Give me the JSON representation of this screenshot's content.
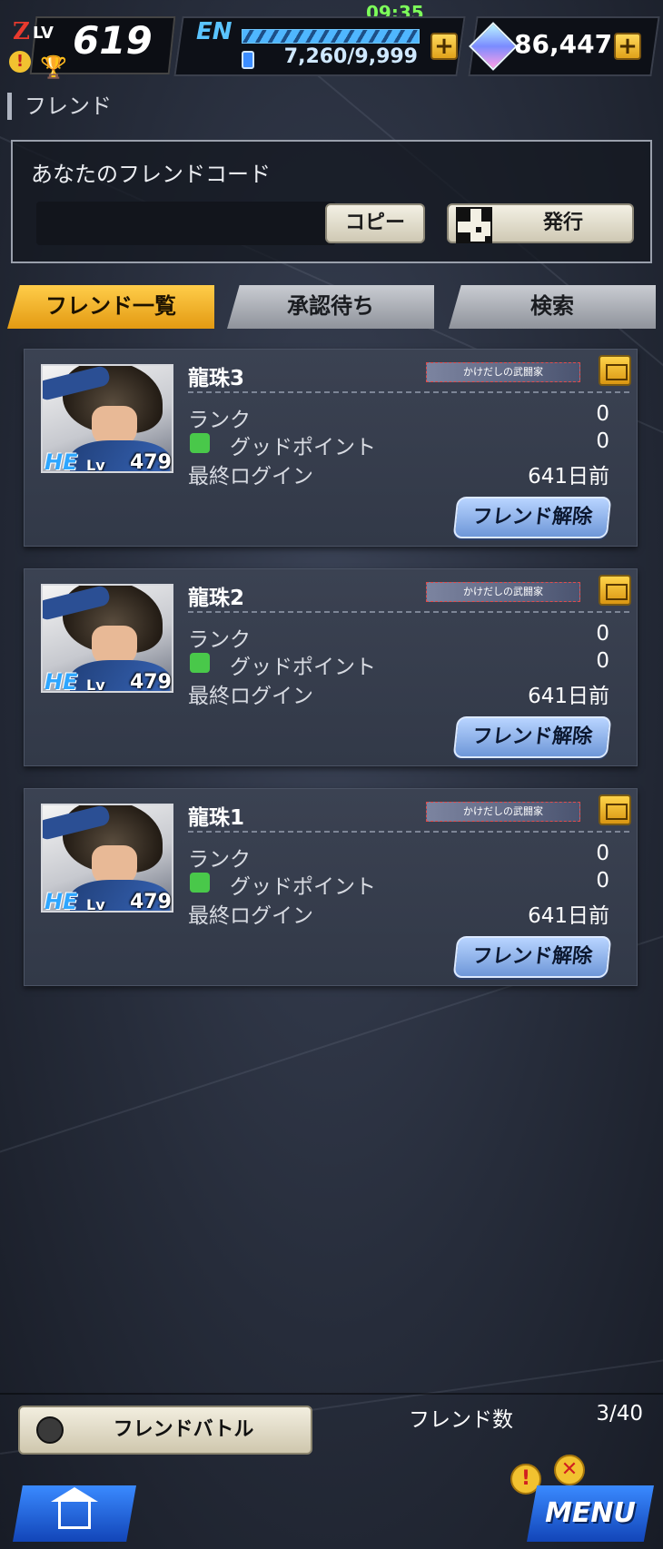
{
  "status": {
    "clock": "09:35",
    "player_level": "619",
    "level_prefix_z": "Z",
    "level_prefix_lv": "LV",
    "energy_label": "EN",
    "energy_value": "7,260/9,999",
    "gems": "86,447"
  },
  "page": {
    "title": "フレンド"
  },
  "friend_code": {
    "title": "あなたのフレンドコード",
    "copy_label": "コピー",
    "issue_label": "発行"
  },
  "tabs": [
    {
      "label": "フレンド一覧",
      "active": true
    },
    {
      "label": "承認待ち",
      "active": false
    },
    {
      "label": "検索",
      "active": false
    }
  ],
  "friends": [
    {
      "name": "龍珠3",
      "title_badge": "かけだしの武闘家",
      "tag": "HE",
      "lv_label": "Lv",
      "level": "479",
      "rank_label": "ランク",
      "rank": "0",
      "good_label": "グッドポイント",
      "good": "0",
      "login_label": "最終ログイン",
      "login": "641日前",
      "unfriend_label": "フレンド解除"
    },
    {
      "name": "龍珠2",
      "title_badge": "かけだしの武闘家",
      "tag": "HE",
      "lv_label": "Lv",
      "level": "479",
      "rank_label": "ランク",
      "rank": "0",
      "good_label": "グッドポイント",
      "good": "0",
      "login_label": "最終ログイン",
      "login": "641日前",
      "unfriend_label": "フレンド解除"
    },
    {
      "name": "龍珠1",
      "title_badge": "かけだしの武闘家",
      "tag": "HE",
      "lv_label": "Lv",
      "level": "479",
      "rank_label": "ランク",
      "rank": "0",
      "good_label": "グッドポイント",
      "good": "0",
      "login_label": "最終ログイン",
      "login": "641日前",
      "unfriend_label": "フレンド解除"
    }
  ],
  "footer": {
    "battle_label": "フレンドバトル",
    "count_label": "フレンド数",
    "count_value": "3/40",
    "menu_label": "MENU"
  }
}
